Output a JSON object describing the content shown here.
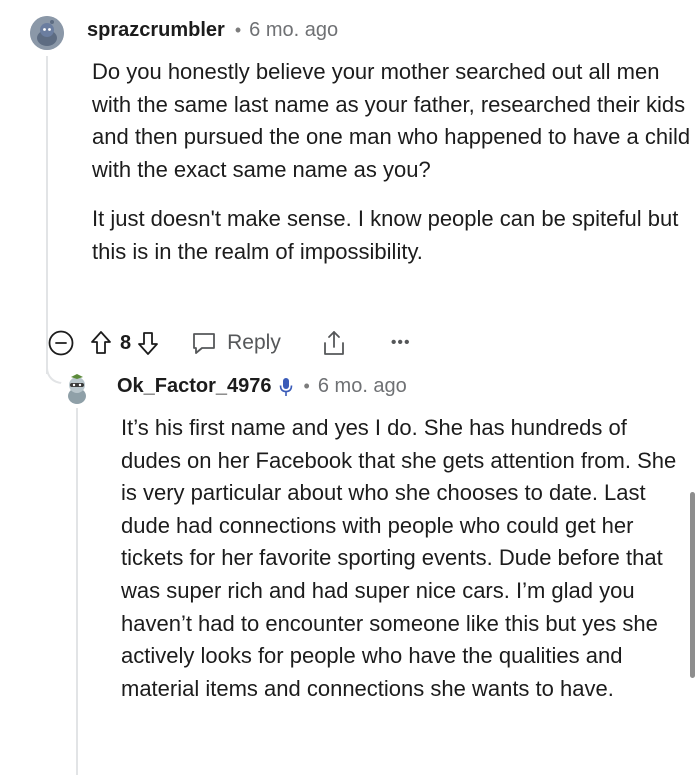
{
  "comment": {
    "username": "sprazcrumbler",
    "separator": "•",
    "time": "6 mo. ago",
    "paragraphs": [
      "Do you honestly believe your mother searched out all men with the same last name as your father, researched their kids and then pursued the one man who happened to have a child with the exact same name as you?",
      "It just doesn't make sense. I know people can be spiteful but this is in the realm of impossibility."
    ],
    "actions": {
      "vote_count": "8",
      "reply_label": "Reply",
      "more_label": "•••"
    }
  },
  "reply": {
    "username": "Ok_Factor_4976",
    "separator": "•",
    "time": "6 mo. ago",
    "paragraphs": [
      "It’s his first name and yes I do. She has hundreds of dudes on her Facebook that she gets attention from. She is very particular about who she chooses to date. Last dude had connections with people who could get her tickets for her favorite sporting events. Dude before that was super rich and had super nice cars. I’m glad you haven’t had to encounter someone like this but yes she actively looks for people who have the qualities and material items and connections she wants to have."
    ]
  },
  "icons": {
    "avatar1": "snoo-avatar-icon",
    "avatar2": "snoo-avatar-icon",
    "mic": "microphone-icon",
    "collapse": "collapse-minus-icon",
    "upvote": "upvote-arrow-icon",
    "downvote": "downvote-arrow-icon",
    "reply": "reply-bubble-icon",
    "share": "share-icon"
  },
  "colors": {
    "text": "#1c1c1c",
    "meta": "#6f7174",
    "icon": "#555759",
    "thread_line": "#e2e4e6",
    "mic": "#3a5bb8"
  }
}
